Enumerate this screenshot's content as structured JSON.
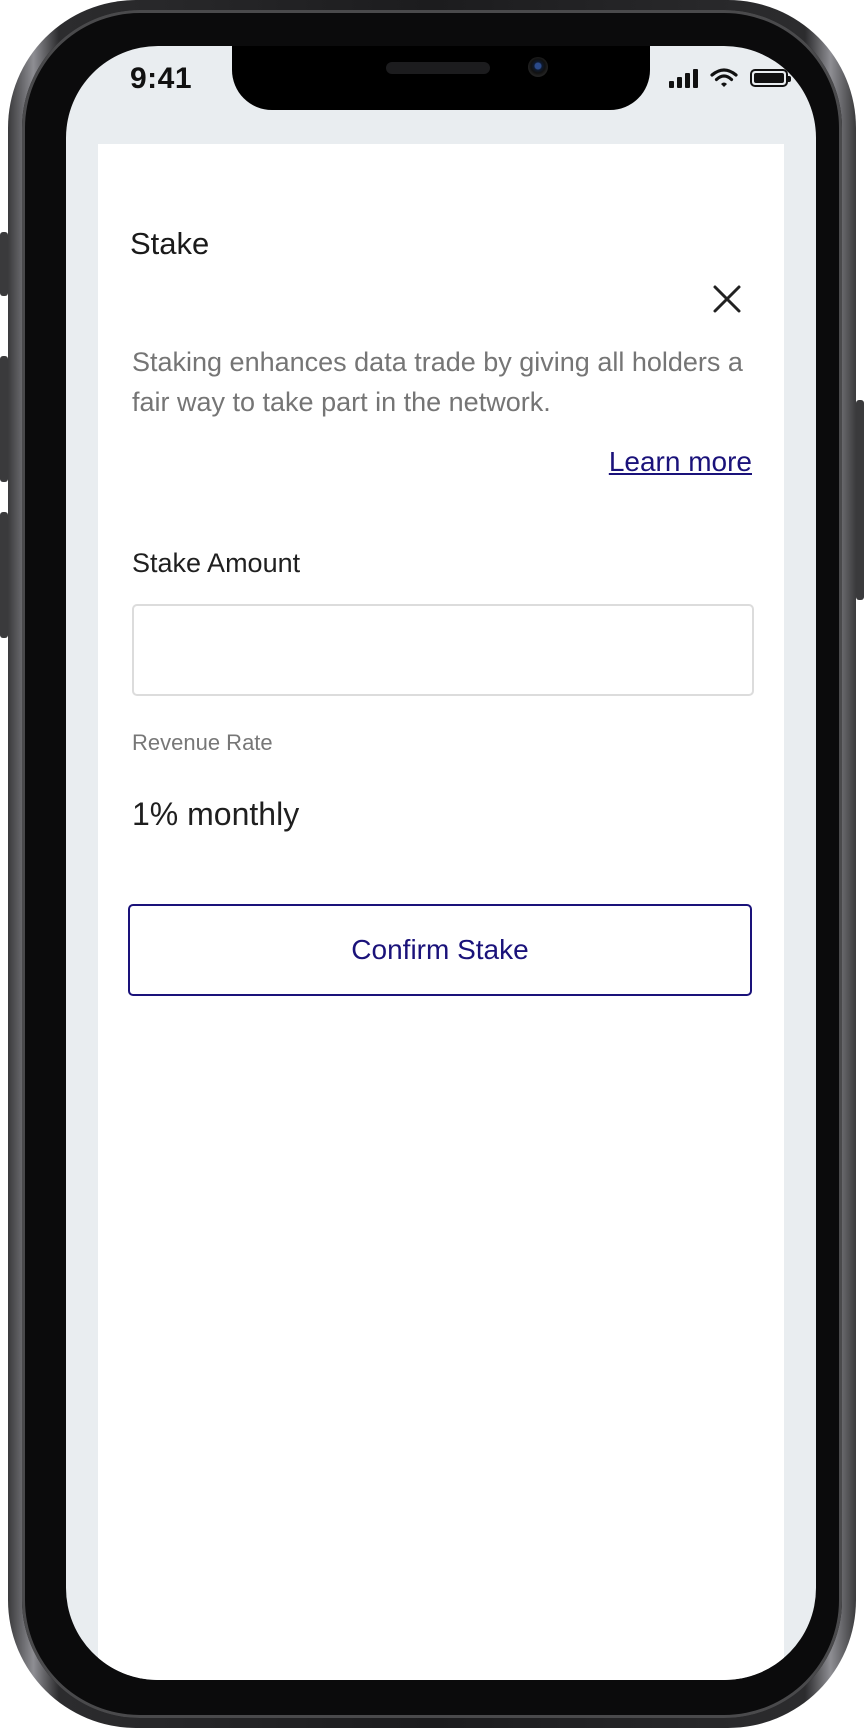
{
  "status_bar": {
    "time": "9:41",
    "icons": [
      "cellular-signal-icon",
      "wifi-icon",
      "battery-icon"
    ]
  },
  "stake_modal": {
    "title": "Stake",
    "close_icon": "close-icon",
    "description": "Staking enhances data trade by giving all holders a fair way to take part in the network.",
    "learn_more_label": "Learn more",
    "amount_label": "Stake Amount",
    "amount_value": "",
    "revenue_rate_label": "Revenue Rate",
    "revenue_rate_value": "1% monthly",
    "confirm_label": "Confirm Stake"
  },
  "colors": {
    "accent": "#1a127a",
    "screen_background": "#e9edf0",
    "card_background": "#ffffff",
    "muted_text": "#757575"
  }
}
